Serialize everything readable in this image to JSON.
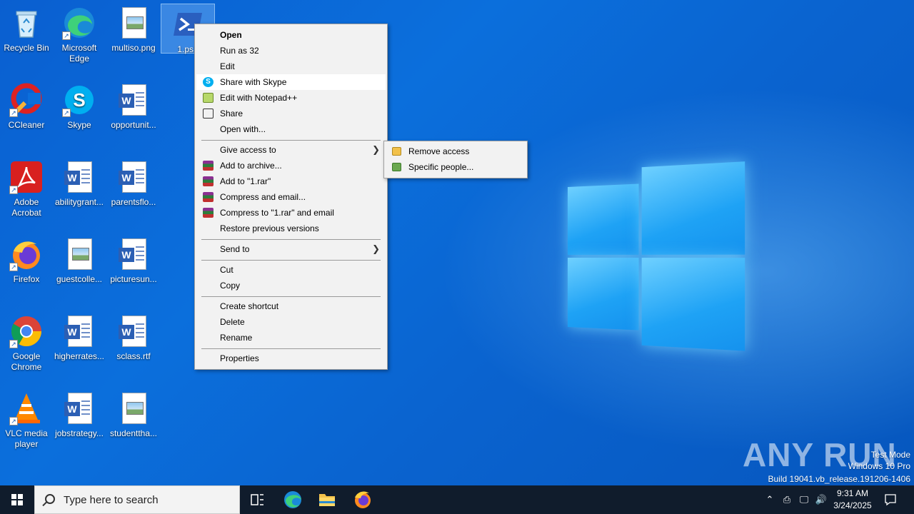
{
  "desktop": {
    "icons": [
      {
        "label": "Recycle Bin",
        "icon": "recycle-bin-icon"
      },
      {
        "label": "Microsoft Edge",
        "icon": "edge-icon"
      },
      {
        "label": "multiso.png",
        "icon": "image-file-icon"
      },
      {
        "label": "1.ps1",
        "icon": "powershell-icon"
      },
      {
        "label": "CCleaner",
        "icon": "ccleaner-icon"
      },
      {
        "label": "Skype",
        "icon": "skype-icon"
      },
      {
        "label": "opportunit...",
        "icon": "word-doc-icon"
      },
      {
        "label": "Adobe Acrobat",
        "icon": "acrobat-icon"
      },
      {
        "label": "abilitygrant...",
        "icon": "word-doc-icon"
      },
      {
        "label": "parentsflo...",
        "icon": "word-doc-icon"
      },
      {
        "label": "Firefox",
        "icon": "firefox-icon"
      },
      {
        "label": "guestcolle...",
        "icon": "image-file-icon"
      },
      {
        "label": "picturesun...",
        "icon": "word-doc-icon"
      },
      {
        "label": "Google Chrome",
        "icon": "chrome-icon"
      },
      {
        "label": "higherrates...",
        "icon": "word-doc-icon"
      },
      {
        "label": "sclass.rtf",
        "icon": "word-doc-icon"
      },
      {
        "label": "VLC media player",
        "icon": "vlc-icon"
      },
      {
        "label": "jobstrategy...",
        "icon": "word-doc-icon"
      },
      {
        "label": "studenttha...",
        "icon": "image-file-icon"
      }
    ]
  },
  "context_menu": {
    "items": [
      {
        "label": "Open"
      },
      {
        "label": "Run as 32"
      },
      {
        "label": "Edit"
      },
      {
        "label": "Share with Skype"
      },
      {
        "label": "Edit with Notepad++"
      },
      {
        "label": "Share"
      },
      {
        "label": "Open with..."
      },
      {
        "label": "Give access to"
      },
      {
        "label": "Add to archive..."
      },
      {
        "label": "Add to \"1.rar\""
      },
      {
        "label": "Compress and email..."
      },
      {
        "label": "Compress to \"1.rar\" and email"
      },
      {
        "label": "Restore previous versions"
      },
      {
        "label": "Send to"
      },
      {
        "label": "Cut"
      },
      {
        "label": "Copy"
      },
      {
        "label": "Create shortcut"
      },
      {
        "label": "Delete"
      },
      {
        "label": "Rename"
      },
      {
        "label": "Properties"
      }
    ]
  },
  "submenu": {
    "items": [
      {
        "label": "Remove access"
      },
      {
        "label": "Specific people..."
      }
    ]
  },
  "watermark": {
    "brand": "ANY RUN",
    "line1": "Test Mode",
    "line2": "Windows 10 Pro",
    "line3": "Build 19041.vb_release.191206-1406"
  },
  "taskbar": {
    "search_placeholder": "Type here to search",
    "time": "9:31 AM",
    "date": "3/24/2025"
  },
  "colors": {
    "desktop_blue": "#0b6fdc",
    "taskbar": "#101c2c",
    "menu_bg": "#f2f2f2"
  }
}
